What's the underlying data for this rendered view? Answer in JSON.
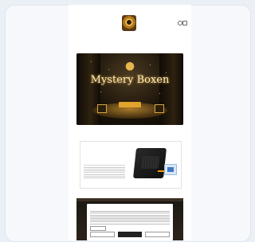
{
  "topbar": {
    "links": [
      "",
      "",
      "",
      "",
      ""
    ],
    "currency": ""
  },
  "nav": {
    "row1": [
      "",
      "",
      "",
      "",
      "",
      ""
    ],
    "row2": [
      "",
      "",
      "",
      "",
      "",
      ""
    ]
  },
  "shipping_notice": "",
  "hero": {
    "title": "Mystery Boxen",
    "cta_label": ""
  },
  "caption": "",
  "product": {
    "kicker": "",
    "title": "",
    "badge_icon": "seal-icon",
    "image": "retro-console-image"
  },
  "cookie_dialog": {
    "title": "",
    "settings_label": "",
    "decline_label": "",
    "accept_label": "",
    "save_label": ""
  },
  "colors": {
    "accent_gold": "#e2a32d",
    "title_navy": "#1f2e5a",
    "hero_dark": "#1b1409"
  }
}
